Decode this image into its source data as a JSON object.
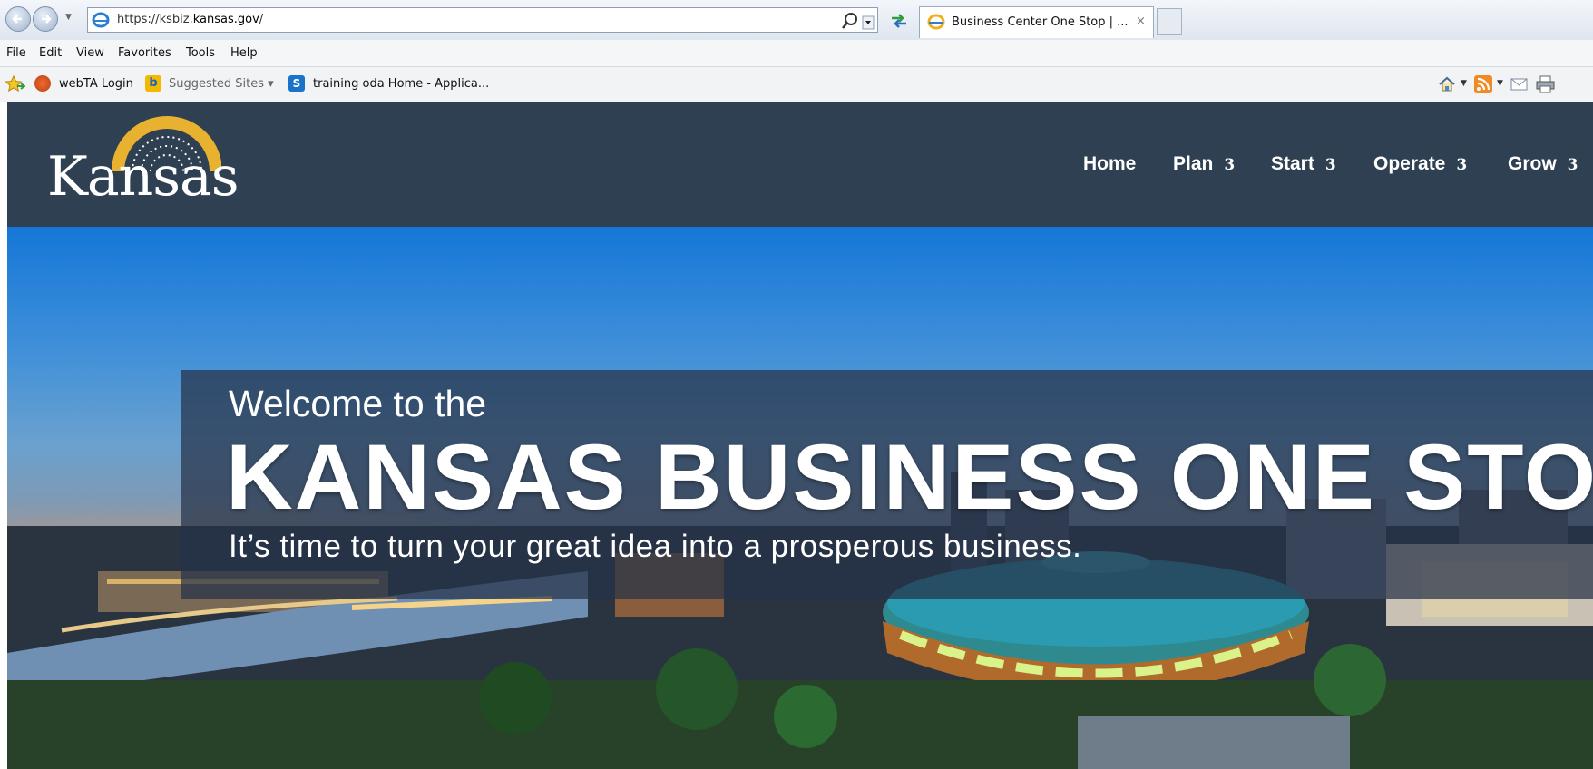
{
  "browser": {
    "address": {
      "url_prefix": "https://ksbiz.",
      "url_domain": "kansas.gov",
      "url_suffix": "/"
    },
    "tab": {
      "title": "Business Center One Stop | ...",
      "close_glyph": "×"
    },
    "menu": [
      "File",
      "Edit",
      "View",
      "Favorites",
      "Tools",
      "Help"
    ],
    "favorites": [
      {
        "label": "webTA Login",
        "icon": "webta-icon"
      },
      {
        "label": "Suggested Sites ▾",
        "icon": "bing-icon"
      },
      {
        "label": "training oda Home - Applica...",
        "icon": "sharepoint-icon"
      }
    ]
  },
  "site": {
    "logo": {
      "text": "Kansas",
      "motto": "AD ASTRA PER ASPERA"
    },
    "nav": [
      {
        "label": "Home",
        "arrow": ""
      },
      {
        "label": "Plan",
        "arrow": "3"
      },
      {
        "label": "Start",
        "arrow": "3"
      },
      {
        "label": "Operate",
        "arrow": "3"
      },
      {
        "label": "Grow",
        "arrow": "3"
      }
    ],
    "hero": {
      "welcome": "Welcome to the",
      "headline": "KANSAS BUSINESS ONE STOP",
      "tagline": "It’s time to turn your great idea into a prosperous business."
    }
  },
  "colors": {
    "header_bg": "#2e4052",
    "banner_bg": "#253248",
    "sky_top": "#1577d8",
    "logo_gold": "#e8b230"
  }
}
